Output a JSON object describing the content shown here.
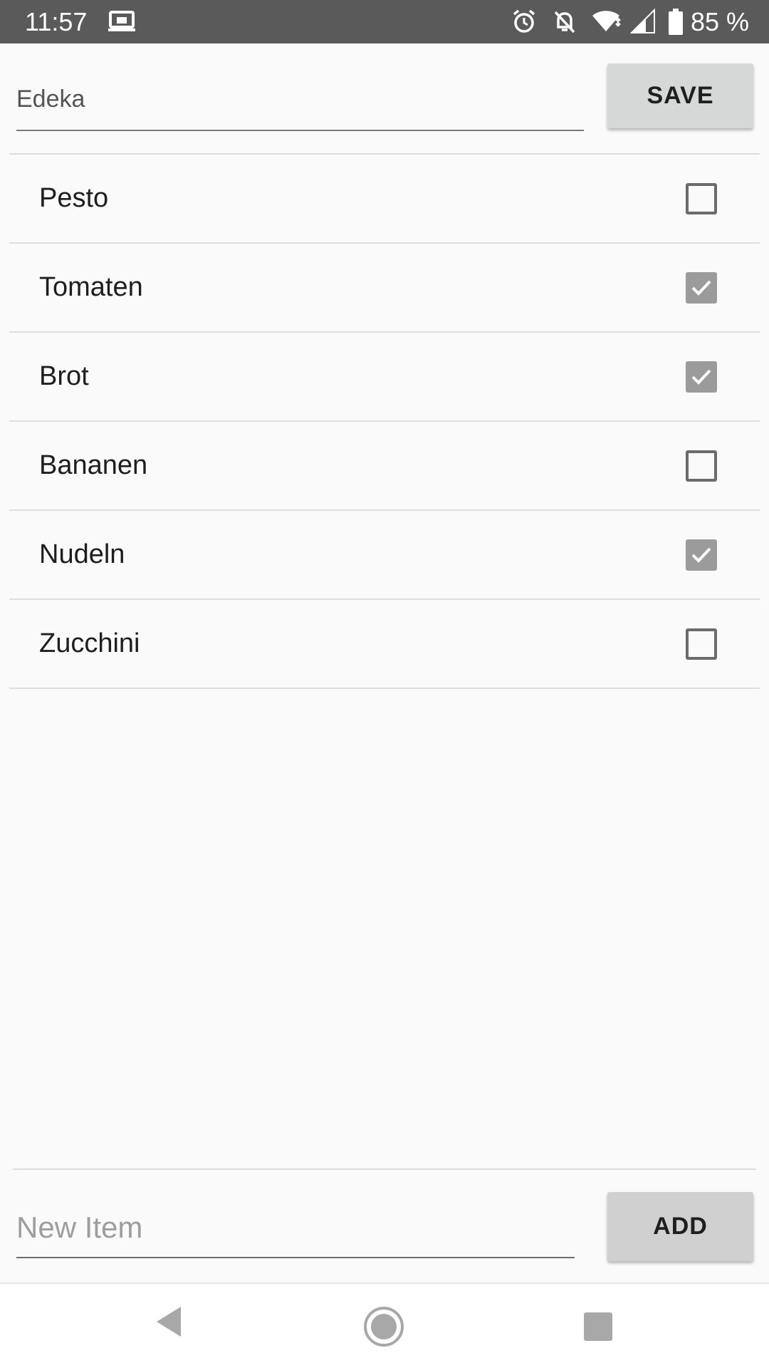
{
  "status_bar": {
    "time": "11:57",
    "battery": "85 %",
    "icons": [
      "cast-icon",
      "alarm-icon",
      "notifications-off-icon",
      "wifi-icon",
      "signal-icon",
      "battery-icon"
    ]
  },
  "header": {
    "store_name": "Edeka",
    "save_label": "SAVE"
  },
  "items": [
    {
      "label": "Pesto",
      "checked": false
    },
    {
      "label": "Tomaten",
      "checked": true
    },
    {
      "label": "Brot",
      "checked": true
    },
    {
      "label": "Bananen",
      "checked": false
    },
    {
      "label": "Nudeln",
      "checked": true
    },
    {
      "label": "Zucchini",
      "checked": false
    }
  ],
  "footer": {
    "new_item_placeholder": "New Item",
    "add_label": "ADD"
  },
  "nav": {
    "icons": [
      "back-icon",
      "home-icon",
      "recents-icon"
    ]
  },
  "colors": {
    "status_bar": "#5a5a5a",
    "background": "#fafafa",
    "button": "#d6d7d7",
    "checkbox_checked": "#9b9b9b"
  }
}
